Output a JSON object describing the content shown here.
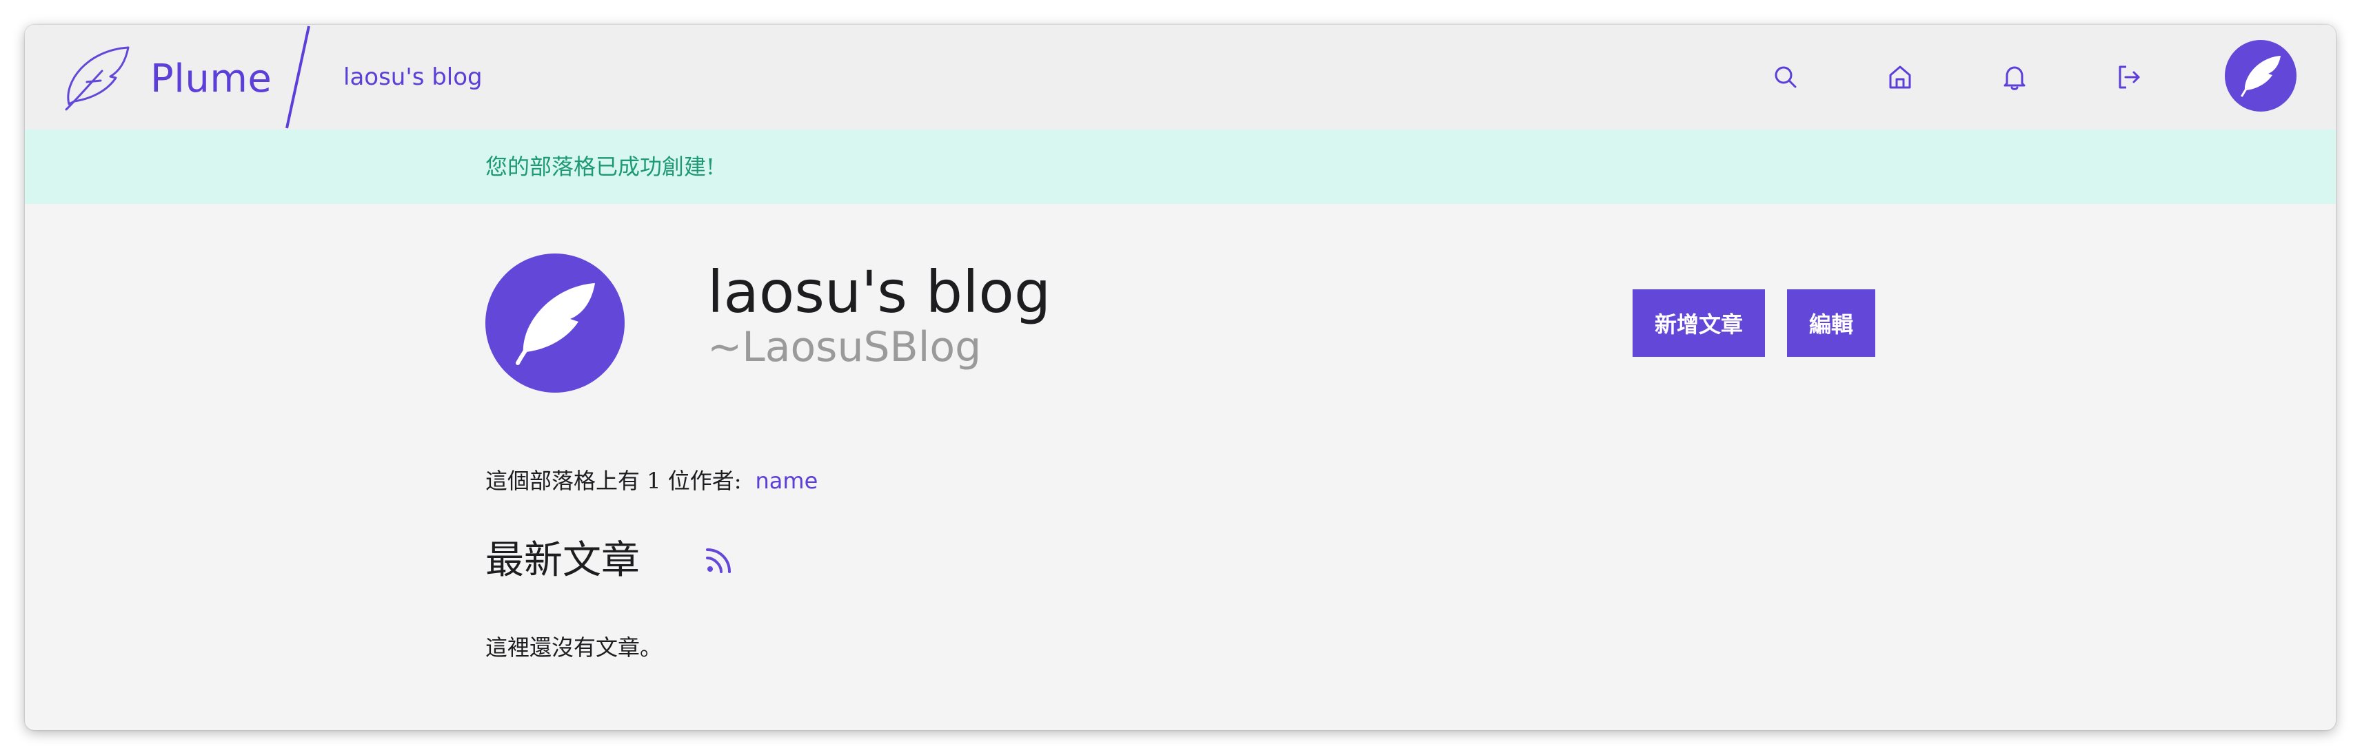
{
  "header": {
    "app_name": "Plume",
    "breadcrumb": "laosu's blog",
    "icons": [
      "feather-logo-icon",
      "search-icon",
      "home-icon",
      "bell-icon",
      "logout-icon",
      "user-avatar"
    ]
  },
  "flash": {
    "message": "您的部落格已成功創建!"
  },
  "blog": {
    "title": "laosu's blog",
    "handle": "~LaosuSBlog",
    "new_article_label": "新增文章",
    "edit_label": "編輯"
  },
  "authors": {
    "label": "這個部落格上有 1 位作者:",
    "names": [
      "name"
    ]
  },
  "latest": {
    "title": "最新文章",
    "empty_message": "這裡還沒有文章。"
  },
  "colors": {
    "accent": "#6247d8",
    "flash_bg": "#d9f7f1",
    "flash_text": "#1d9a72",
    "page_bg": "#f4f4f5",
    "header_bg": "#efeff0"
  }
}
